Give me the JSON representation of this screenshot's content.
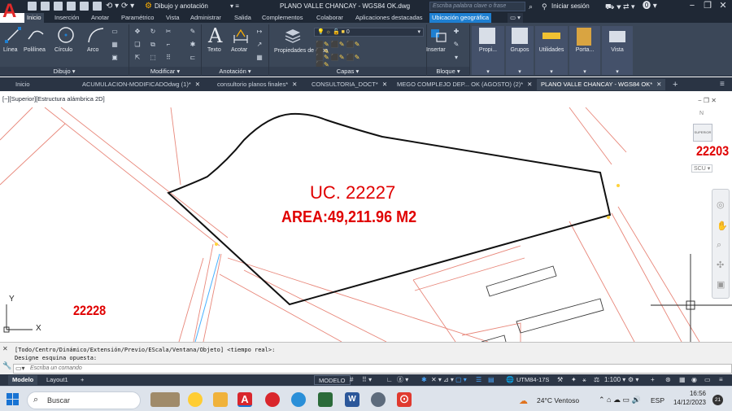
{
  "titlebar": {
    "workspace": "Dibujo y anotación",
    "title": "PLANO VALLE CHANCAY - WGS84 OK.dwg",
    "search_placeholder": "Escriba palabra clave o frase",
    "signin": "Iniciar sesión"
  },
  "ribbon_tabs": [
    "Inicio",
    "Inserción",
    "Anotar",
    "Paramétrico",
    "Vista",
    "Administrar",
    "Salida",
    "Complementos",
    "Colaborar",
    "Aplicaciones destacadas",
    "Ubicación geográfica"
  ],
  "ribbon": {
    "draw_tools": [
      "Línea",
      "Polilínea",
      "Círculo",
      "Arco"
    ],
    "panels": [
      "Dibujo",
      "Modificar",
      "Anotación",
      "Capas",
      "Bloque"
    ],
    "text_label": "Texto",
    "dim_label": "Acotar",
    "props_label": "Propiedades de capa",
    "layer_value": "0",
    "insert_label": "Insertar",
    "right_groups": [
      "Propi...",
      "Grupos",
      "Utilidades",
      "Porta...",
      "Vista"
    ]
  },
  "doc_tabs": [
    "Inicio",
    "ACUMULACION-MODIFICADOdwg (1)*",
    "consultorio planos finales*",
    "CONSULTORIA_DOCT*",
    "MEGO COMPLEJO DEP... OK (AGOSTO) (2)*",
    "PLANO VALLE CHANCAY - WGS84 OK*"
  ],
  "drawing": {
    "view_label": "[−][Superior][Estructura alámbrica 2D]",
    "lot_title": "UC. 22227",
    "lot_area": "AREA:49,211.96 M2",
    "label_right": "22203",
    "label_left": "22228",
    "viewcube_top": "SUPERIOR",
    "viewcube_n": "N",
    "ucs_label": "SCU",
    "axis_x": "X",
    "axis_y": "Y",
    "colors": {
      "lot_text": "#e00000",
      "parcel_lines": "#e8877a",
      "lot_outline": "#000000"
    }
  },
  "command": {
    "line1": "[Todo/Centro/Dinámico/Extensión/Previo/EScala/Ventana/Objeto] <tiempo real>:",
    "line2": "Designe esquina opuesta:",
    "placeholder": "Escriba un comando"
  },
  "status": {
    "tabs": [
      "Modelo",
      "Layout1"
    ],
    "mode": "MODELO",
    "coord_system": "UTM84-17S",
    "scale": "1:100"
  },
  "taskbar": {
    "search": "Buscar",
    "weather": "24°C  Ventoso",
    "lang": "ESP",
    "time": "16:56",
    "date": "14/12/2023",
    "notif": "21"
  }
}
